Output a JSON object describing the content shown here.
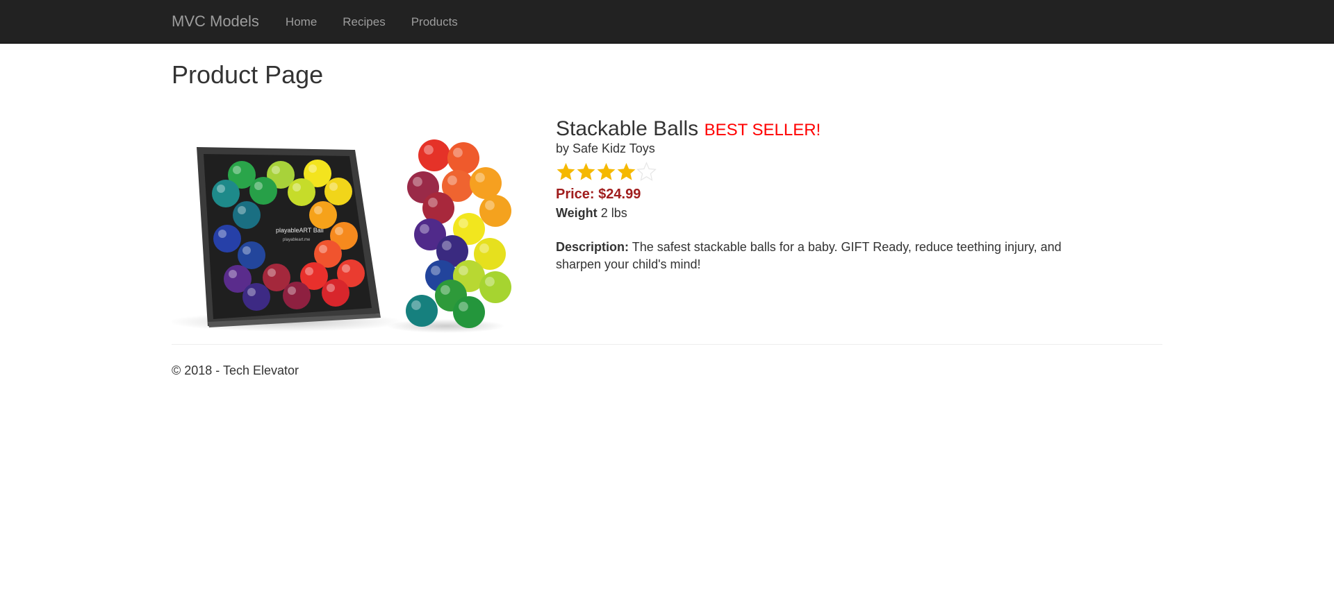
{
  "navbar": {
    "brand": "MVC Models",
    "links": [
      "Home",
      "Recipes",
      "Products"
    ]
  },
  "page": {
    "title": "Product Page"
  },
  "product": {
    "name": "Stackable Balls",
    "badge": "BEST SELLER!",
    "brand_line": "by Safe Kidz Toys",
    "rating": 4,
    "rating_max": 5,
    "price_text": "Price: $24.99",
    "weight_label": "Weight",
    "weight_value": "2 lbs",
    "description_label": "Description:",
    "description_text": "The safest stackable balls for a baby. GIFT Ready, reduce teething injury, and sharpen your child's mind!",
    "image_box_text": "playableART Ball",
    "image_box_subtext": "playableart.me"
  },
  "footer": {
    "text": "© 2018 - Tech Elevator"
  },
  "colors": {
    "navbar_bg": "#222222",
    "nav_text": "#9d9d9d",
    "badge": "#ff0000",
    "price": "#a01d1d",
    "star_filled": "#f5b800",
    "star_empty": "#e6e6e6"
  }
}
